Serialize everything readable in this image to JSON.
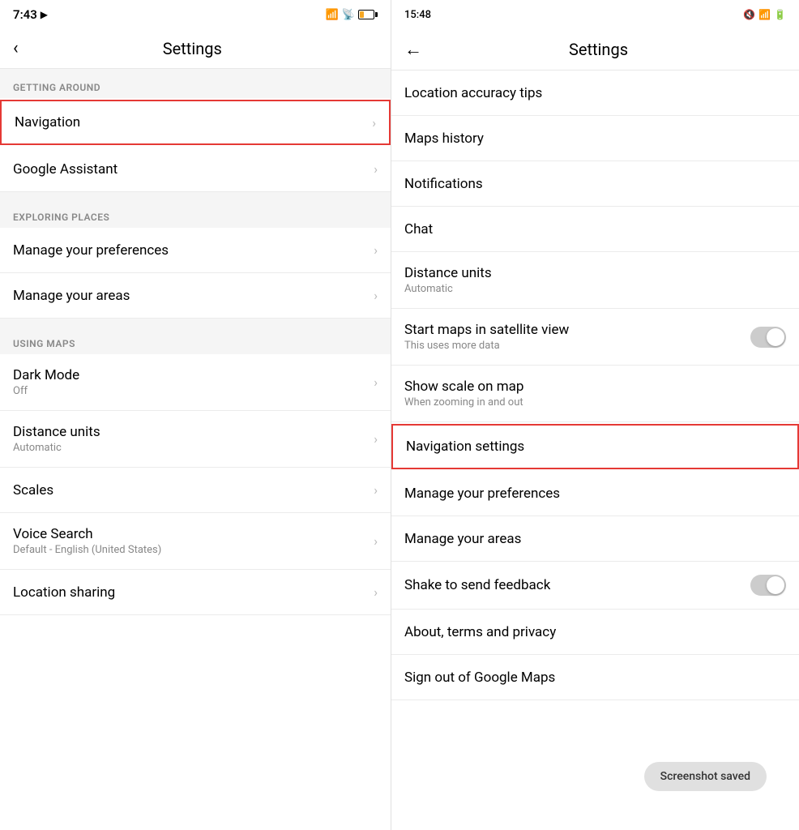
{
  "left": {
    "statusBar": {
      "time": "7:43",
      "locationIcon": "▶"
    },
    "header": {
      "backLabel": "‹",
      "title": "Settings"
    },
    "sections": [
      {
        "id": "getting-around",
        "header": "GETTING AROUND",
        "items": [
          {
            "id": "navigation",
            "label": "Navigation",
            "sublabel": "",
            "hasChevron": true,
            "highlighted": true
          },
          {
            "id": "google-assistant",
            "label": "Google Assistant",
            "sublabel": "",
            "hasChevron": true,
            "highlighted": false
          }
        ]
      },
      {
        "id": "exploring-places",
        "header": "EXPLORING PLACES",
        "items": [
          {
            "id": "manage-preferences",
            "label": "Manage your preferences",
            "sublabel": "",
            "hasChevron": true,
            "highlighted": false
          },
          {
            "id": "manage-areas",
            "label": "Manage your areas",
            "sublabel": "",
            "hasChevron": true,
            "highlighted": false
          }
        ]
      },
      {
        "id": "using-maps",
        "header": "USING MAPS",
        "items": [
          {
            "id": "dark-mode",
            "label": "Dark Mode",
            "sublabel": "Off",
            "hasChevron": true,
            "highlighted": false
          },
          {
            "id": "distance-units",
            "label": "Distance units",
            "sublabel": "Automatic",
            "hasChevron": true,
            "highlighted": false
          },
          {
            "id": "scales",
            "label": "Scales",
            "sublabel": "",
            "hasChevron": true,
            "highlighted": false
          },
          {
            "id": "voice-search",
            "label": "Voice Search",
            "sublabel": "Default - English (United States)",
            "hasChevron": true,
            "highlighted": false
          },
          {
            "id": "location-sharing",
            "label": "Location sharing",
            "sublabel": "",
            "hasChevron": true,
            "highlighted": false
          }
        ]
      }
    ]
  },
  "right": {
    "statusBar": {
      "time": "15:48"
    },
    "header": {
      "backLabel": "←",
      "title": "Settings"
    },
    "items": [
      {
        "id": "location-accuracy",
        "label": "Location accuracy tips",
        "sublabel": "",
        "hasChevron": false,
        "hasToggle": false,
        "highlighted": false
      },
      {
        "id": "maps-history",
        "label": "Maps history",
        "sublabel": "",
        "hasChevron": false,
        "hasToggle": false,
        "highlighted": false
      },
      {
        "id": "notifications",
        "label": "Notifications",
        "sublabel": "",
        "hasChevron": false,
        "hasToggle": false,
        "highlighted": false
      },
      {
        "id": "chat",
        "label": "Chat",
        "sublabel": "",
        "hasChevron": false,
        "hasToggle": false,
        "highlighted": false
      },
      {
        "id": "right-distance-units",
        "label": "Distance units",
        "sublabel": "Automatic",
        "hasChevron": false,
        "hasToggle": false,
        "highlighted": false
      },
      {
        "id": "satellite-view",
        "label": "Start maps in satellite view",
        "sublabel": "This uses more data",
        "hasChevron": false,
        "hasToggle": true,
        "highlighted": false
      },
      {
        "id": "show-scale",
        "label": "Show scale on map",
        "sublabel": "When zooming in and out",
        "hasChevron": false,
        "hasToggle": false,
        "highlighted": false
      },
      {
        "id": "navigation-settings",
        "label": "Navigation settings",
        "sublabel": "",
        "hasChevron": false,
        "hasToggle": false,
        "highlighted": true
      },
      {
        "id": "right-manage-preferences",
        "label": "Manage your preferences",
        "sublabel": "",
        "hasChevron": false,
        "hasToggle": false,
        "highlighted": false
      },
      {
        "id": "right-manage-areas",
        "label": "Manage your areas",
        "sublabel": "",
        "hasChevron": false,
        "hasToggle": false,
        "highlighted": false
      },
      {
        "id": "shake-feedback",
        "label": "Shake to send feedback",
        "sublabel": "",
        "hasChevron": false,
        "hasToggle": true,
        "highlighted": false
      },
      {
        "id": "about-terms",
        "label": "About, terms and privacy",
        "sublabel": "",
        "hasChevron": false,
        "hasToggle": false,
        "highlighted": false
      },
      {
        "id": "sign-out",
        "label": "Sign out of Google Maps",
        "sublabel": "",
        "hasChevron": false,
        "hasToggle": false,
        "highlighted": false
      }
    ],
    "toast": "Screenshot saved"
  },
  "icons": {
    "chevron": "›",
    "back": "‹",
    "rightArrow": "→"
  }
}
